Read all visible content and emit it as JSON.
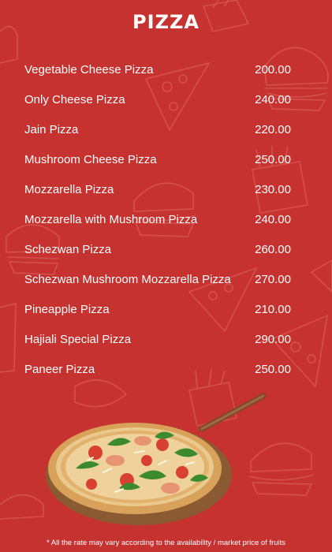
{
  "header": {
    "title": "PIZZA"
  },
  "menu": {
    "items": [
      {
        "name": "Vegetable Cheese Pizza",
        "price": "200.00"
      },
      {
        "name": "Only Cheese Pizza",
        "price": "240.00"
      },
      {
        "name": "Jain Pizza",
        "price": "220.00"
      },
      {
        "name": "Mushroom Cheese Pizza",
        "price": "250.00"
      },
      {
        "name": "Mozzarella Pizza",
        "price": "230.00"
      },
      {
        "name": "Mozzarella with Mushroom Pizza",
        "price": "240.00"
      },
      {
        "name": "Schezwan Pizza",
        "price": "260.00"
      },
      {
        "name": "Schezwan Mushroom Mozzarella Pizza",
        "price": "270.00"
      },
      {
        "name": "Pineapple Pizza",
        "price": "210.00"
      },
      {
        "name": "Hajiali Special Pizza",
        "price": "290.00"
      },
      {
        "name": "Paneer Pizza",
        "price": "250.00"
      }
    ]
  },
  "footer": {
    "note": "* All the rate may vary according to the availability / market price of fruits"
  },
  "colors": {
    "background": "#c5322f",
    "text": "#ffffff",
    "doodle": "#e26a66"
  },
  "images": {
    "hero": "pizza-on-wooden-peel",
    "background_pattern": "fast-food-doodles"
  }
}
